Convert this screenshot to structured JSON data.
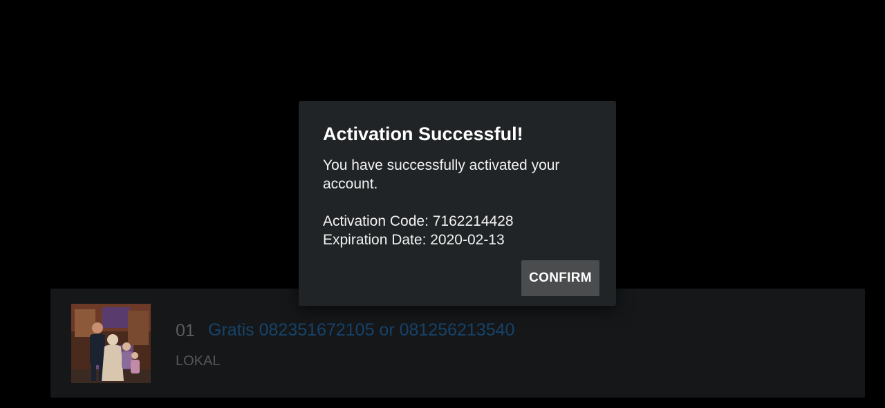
{
  "channel_list": {
    "items": [
      {
        "number": "01",
        "name": "Gratis 082351672105 or 081256213540",
        "category": "LOKAL",
        "thumbnail": "family-photo"
      }
    ]
  },
  "loading": {
    "icon": "spinner-icon"
  },
  "dialog": {
    "title": "Activation Successful!",
    "message": "You have successfully activated your account.",
    "activation_code_line": "Activation Code: 7162214428",
    "expiration_date_line": "Expiration Date: 2020-02-13",
    "confirm_label": "CONFIRM"
  },
  "colors": {
    "background": "#000000",
    "dialog_bg": "#212426",
    "button_bg": "#4a4c4e",
    "channel_name": "#17436a"
  }
}
